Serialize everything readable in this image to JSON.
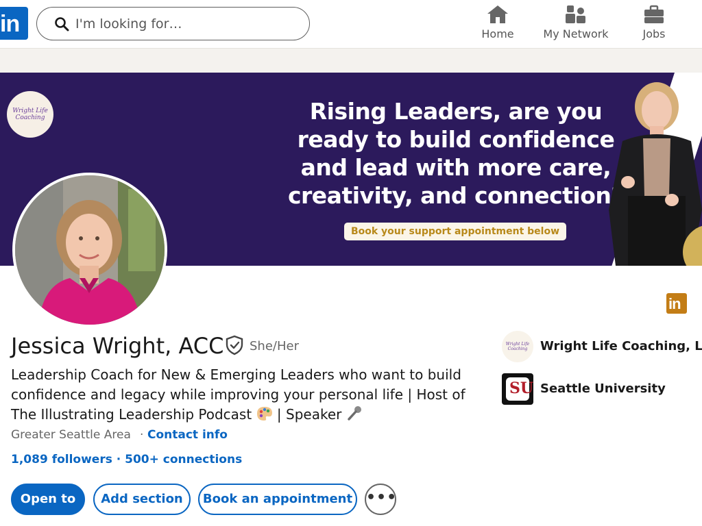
{
  "nav": {
    "logo_text": "in",
    "search_placeholder": "I'm looking for…",
    "items": [
      {
        "label": "Home",
        "icon": "home-icon"
      },
      {
        "label": "My Network",
        "icon": "network-icon"
      },
      {
        "label": "Jobs",
        "icon": "briefcase-icon"
      }
    ]
  },
  "banner": {
    "badge_text": "Wright Life Coaching",
    "headline_lines": [
      "Rising Leaders, are you",
      "ready to build confidence",
      "and lead with more care,",
      "creativity, and connection?"
    ],
    "cta": "Book your support appointment below",
    "colors": {
      "background": "#2c1a5c",
      "cta_text": "#b8891a"
    }
  },
  "profile": {
    "name": "Jessica Wright, ACC",
    "pronouns": "She/Her",
    "headline_line1": "Leadership Coach for New & Emerging Leaders who want to build",
    "headline_line2": "confidence and legacy while improving your personal life | Host of",
    "headline_line3a": "The Illustrating Leadership Podcast",
    "headline_line3b": "| Speaker",
    "location": "Greater Seattle Area",
    "contact_info": "Contact info",
    "followers": "1,089 followers · 500+ connections"
  },
  "actions": {
    "open_to": "Open to",
    "add_section": "Add section",
    "book_appointment": "Book an appointment",
    "more": "•••"
  },
  "right": {
    "li_badge": "in",
    "orgs": [
      {
        "name": "Wright Life Coaching, LLC",
        "logo_text": "Wright Life Coaching"
      },
      {
        "name": "Seattle University",
        "logo_text": "SU"
      }
    ]
  },
  "colors": {
    "brand": "#0a66c2",
    "text": "#191919",
    "muted": "#666666"
  }
}
